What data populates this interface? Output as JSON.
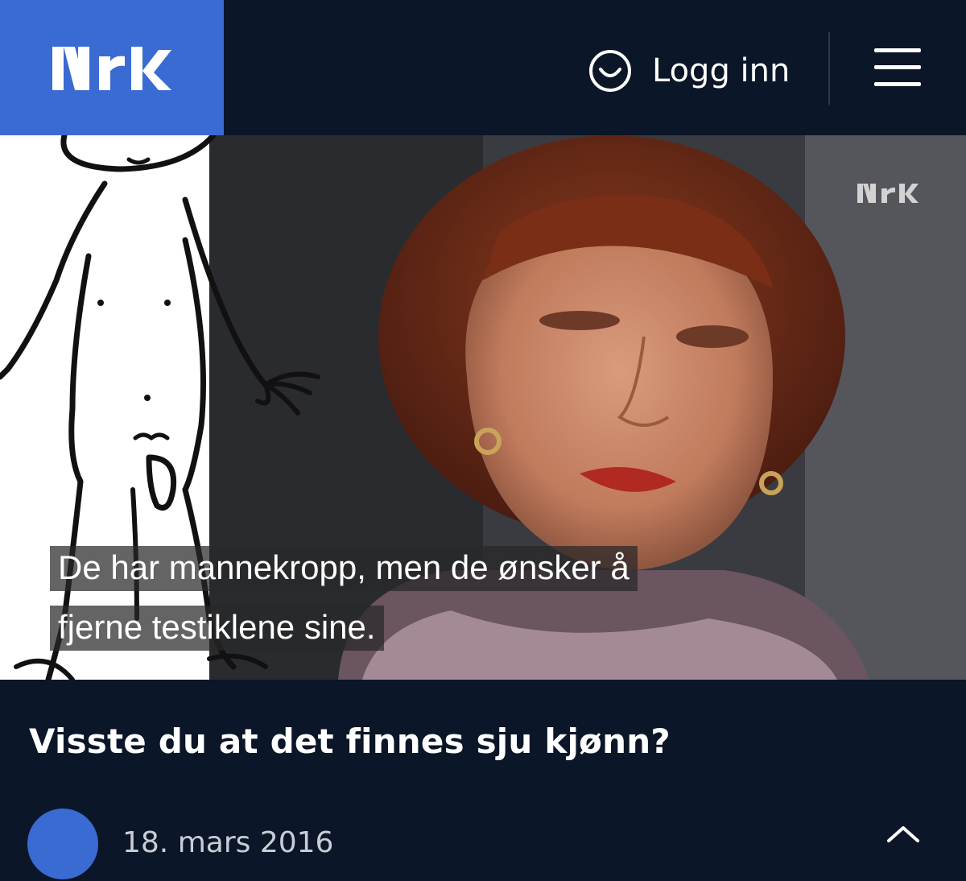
{
  "header": {
    "logo_text": "NRK",
    "login_label": "Logg inn",
    "login_icon": "smiley-user-icon",
    "menu_icon": "hamburger-menu-icon"
  },
  "video": {
    "watermark": "NRK",
    "subtitle_line1": "De har mannekropp, men de ønsker å",
    "subtitle_line2": "fjerne testiklene sine."
  },
  "article": {
    "title": "Visste du at det finnes sju kjønn?",
    "date": "18. mars 2016",
    "collapse_icon": "chevron-up-icon"
  },
  "colors": {
    "background": "#0b1628",
    "brand_blue": "#3a6bd3",
    "text": "#ffffff",
    "date_text": "#c9ced6"
  }
}
